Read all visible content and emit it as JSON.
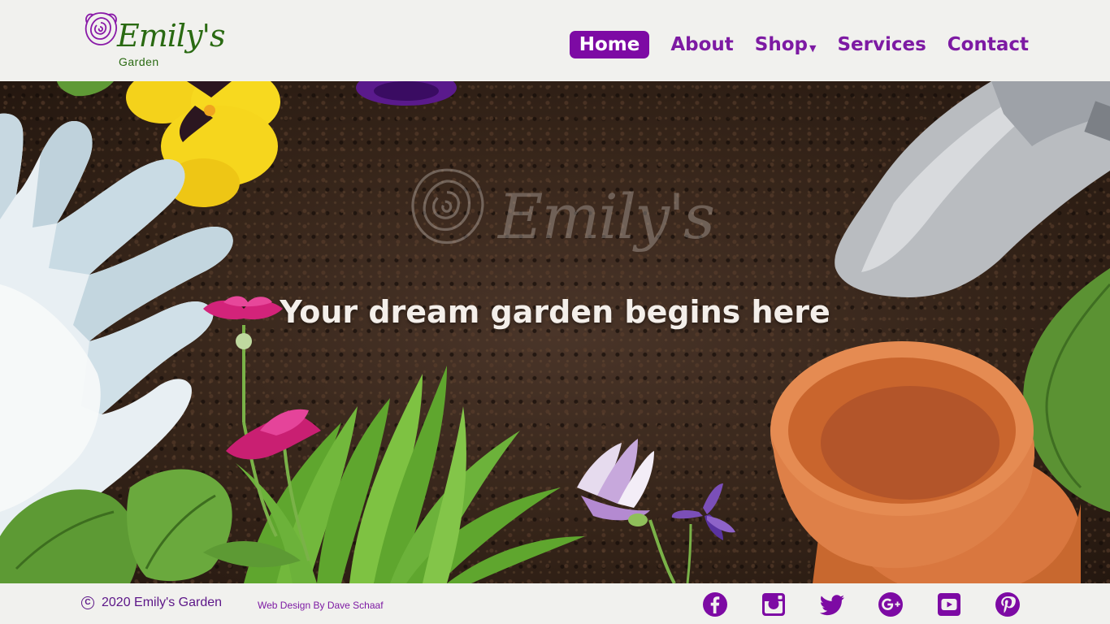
{
  "brand": {
    "name": "Emily's",
    "subtitle": "Garden"
  },
  "nav": {
    "items": [
      {
        "label": "Home",
        "active": true
      },
      {
        "label": "About"
      },
      {
        "label": "Shop",
        "dropdown": true
      },
      {
        "label": "Services"
      },
      {
        "label": "Contact"
      }
    ],
    "caret": "▼"
  },
  "hero": {
    "watermark_text": "Emily's",
    "tagline": "Your dream garden begins here"
  },
  "footer": {
    "copyright_symbol": "C",
    "copyright_text": "2020 Emily's Garden",
    "credit": "Web Design By Dave Schaaf",
    "social": [
      {
        "name": "facebook-icon"
      },
      {
        "name": "instagram-icon"
      },
      {
        "name": "twitter-icon"
      },
      {
        "name": "google-plus-icon"
      },
      {
        "name": "youtube-icon"
      },
      {
        "name": "pinterest-icon"
      }
    ]
  },
  "colors": {
    "accent": "#7d0aa4",
    "logo_green": "#2a6a12",
    "background": "#f1f1ee",
    "soil": "#352419"
  }
}
